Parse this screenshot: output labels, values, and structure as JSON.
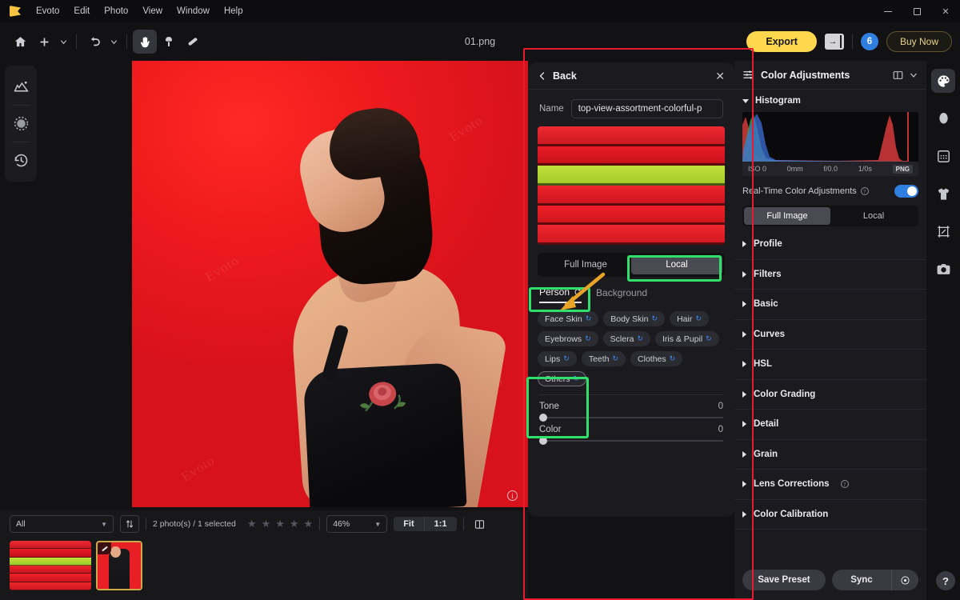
{
  "titlebar": {
    "app_name": "Evoto",
    "menus": [
      "Edit",
      "Photo",
      "View",
      "Window",
      "Help"
    ],
    "window_controls": {
      "minimize": "minimize-icon",
      "maximize": "maximize-icon",
      "close": "✕"
    }
  },
  "toolbar": {
    "home_icon": "home-icon",
    "add_icon": "plus-icon",
    "add_chevron": "chevron-down-icon",
    "undo_icon": "undo-icon",
    "undo_chevron": "chevron-down-icon",
    "hand_icon": "hand-tool-icon",
    "clone_icon": "clone-stamp-icon",
    "heal_icon": "healing-brush-icon",
    "document_title": "01.png",
    "export_label": "Export",
    "panel_toggle_icon": "panel-collapse-icon",
    "credits_count": "6",
    "buy_label": "Buy Now"
  },
  "left_rail": {
    "items": [
      {
        "icon": "image-scene-icon",
        "name": "scene-tool"
      },
      {
        "icon": "retouch-dots-icon",
        "name": "retouch-tool"
      },
      {
        "icon": "history-clock-icon",
        "name": "history-tool"
      }
    ]
  },
  "canvas": {
    "watermarks": [
      "Evoto",
      "Evoto",
      "Evoto",
      "Evoto"
    ],
    "info_icon": "i"
  },
  "mid_panel": {
    "back_label": "Back",
    "back_icon": "chevron-left-icon",
    "close_icon": "✕",
    "name_label": "Name",
    "name_value": "top-view-assortment-colorful-p",
    "preview_bands": [
      "#e0212c",
      "#e21a26",
      "#b4e033",
      "#e8202a",
      "#ea1f28",
      "#e42029"
    ],
    "scope_tabs": [
      {
        "label": "Full Image",
        "active": false
      },
      {
        "label": "Local",
        "active": true
      }
    ],
    "subject_tabs": [
      {
        "label": "Person",
        "active": true,
        "badge": "refresh-icon"
      },
      {
        "label": "Background",
        "active": false,
        "badge": ""
      }
    ],
    "chips": [
      {
        "label": "Face Skin",
        "outlined": false
      },
      {
        "label": "Body Skin",
        "outlined": false
      },
      {
        "label": "Hair",
        "outlined": false
      },
      {
        "label": "Eyebrows",
        "outlined": false
      },
      {
        "label": "Sclera",
        "outlined": false
      },
      {
        "label": "Iris & Pupil",
        "outlined": false
      },
      {
        "label": "Lips",
        "outlined": false
      },
      {
        "label": "Teeth",
        "outlined": false
      },
      {
        "label": "Clothes",
        "outlined": false
      },
      {
        "label": "Others",
        "outlined": true
      }
    ],
    "sliders": [
      {
        "label": "Tone",
        "value": "0"
      },
      {
        "label": "Color",
        "value": "0"
      }
    ]
  },
  "annotations": {
    "highlight_color": "#2fe06a",
    "focus_color": "#e81c2e",
    "arrow_color": "#e8a427"
  },
  "right_panel": {
    "header_title": "Color Adjustments",
    "header_icon": "sliders-icon",
    "layout_icon": "split-view-icon",
    "collapse_icon": "chevron-down-icon",
    "histogram": {
      "label": "Histogram",
      "meta": {
        "iso": "ISO 0",
        "focal": "0mm",
        "aperture": "f/0.0",
        "shutter": "1/0s",
        "format": "PNG"
      }
    },
    "realtime": {
      "label": "Real-Time Color Adjustments",
      "help_icon": "?",
      "enabled": true
    },
    "scope_tabs": [
      {
        "label": "Full Image",
        "active": true
      },
      {
        "label": "Local",
        "active": false
      }
    ],
    "sections": [
      {
        "label": "Profile",
        "help": false
      },
      {
        "label": "Filters",
        "help": false
      },
      {
        "label": "Basic",
        "help": false
      },
      {
        "label": "Curves",
        "help": false
      },
      {
        "label": "HSL",
        "help": false
      },
      {
        "label": "Color Grading",
        "help": false
      },
      {
        "label": "Detail",
        "help": false
      },
      {
        "label": "Grain",
        "help": false
      },
      {
        "label": "Lens Corrections",
        "help": true
      },
      {
        "label": "Color Calibration",
        "help": false
      }
    ],
    "footer": {
      "save_preset_label": "Save Preset",
      "sync_label": "Sync",
      "sync_gear_icon": "gear-icon",
      "help_label": "?"
    }
  },
  "icon_rail": {
    "items": [
      {
        "icon": "palette-icon",
        "name": "color-adjustments-tab",
        "active": true
      },
      {
        "icon": "face-icon",
        "name": "face-retouch-tab",
        "active": false
      },
      {
        "icon": "texture-icon",
        "name": "texture-tab",
        "active": false
      },
      {
        "icon": "shirt-icon",
        "name": "clothes-tab",
        "active": false
      },
      {
        "icon": "crop-icon",
        "name": "crop-tab",
        "active": false
      },
      {
        "icon": "camera-icon",
        "name": "camera-tab",
        "active": false
      }
    ]
  },
  "bottom_bar": {
    "filter_value": "All",
    "sort_icon": "sort-icon",
    "photo_count": "2 photo(s) / 1 selected",
    "stars": 5,
    "zoom_value": "46%",
    "fit_label": "Fit",
    "one_to_one_label": "1:1",
    "compare_icon": "compare-view-icon",
    "thumbnails": [
      {
        "name": "thumb-stripes",
        "type": "wide"
      },
      {
        "name": "thumb-model",
        "type": "tall",
        "selected": true,
        "badge": "edited-icon"
      }
    ]
  }
}
